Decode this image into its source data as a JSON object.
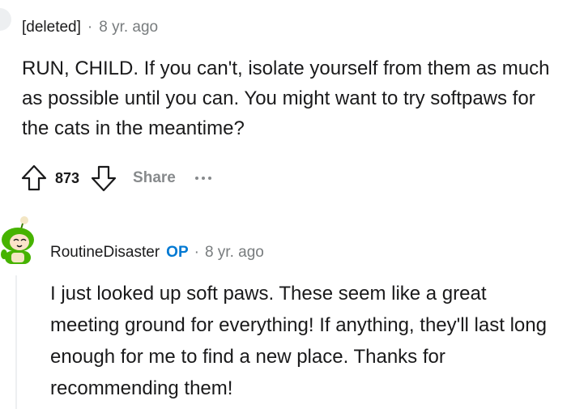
{
  "comment1": {
    "author": "[deleted]",
    "separator": "·",
    "time": "8 yr. ago",
    "body": "RUN, CHILD. If you can't, isolate yourself from them as much as possible until you can. You might want to try softpaws for the cats in the meantime?",
    "score": "873",
    "share_label": "Share",
    "icons": [
      "arrow-up-icon",
      "arrow-down-icon",
      "more-icon"
    ]
  },
  "comment2": {
    "author": "RoutineDisaster",
    "op_badge": "OP",
    "separator": "·",
    "time": "8 yr. ago",
    "body": "I just looked up soft paws. These seem like a great meeting ground for everything! If anything, they'll last long enough for me to find a new place. Thanks for recommending them!"
  },
  "colors": {
    "op": "#0079d3",
    "meta": "#787c7e",
    "action": "#878a8c",
    "avatar_green": "#46b300"
  }
}
